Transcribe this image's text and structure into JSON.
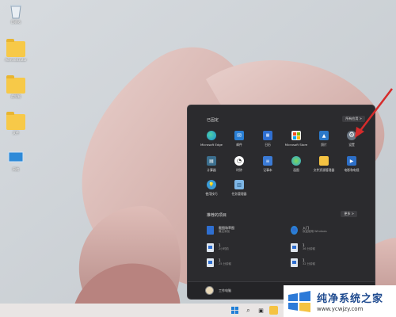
{
  "desktop": {
    "icons": [
      {
        "label": "回收站",
        "kind": "recycle"
      },
      {
        "label": "Administrator",
        "kind": "folder"
      },
      {
        "label": "此电脑",
        "kind": "folder"
      },
      {
        "label": "文件",
        "kind": "folder"
      },
      {
        "label": "网络",
        "kind": "monitor"
      }
    ]
  },
  "start_menu": {
    "pinned_title": "已固定",
    "all_apps_label": "所有应用 >",
    "pinned": [
      {
        "name": "Microsoft Edge",
        "icon": "edge-icon",
        "color": "#1a8fd6"
      },
      {
        "name": "邮件",
        "icon": "mail-icon",
        "color": "#2a7fd4"
      },
      {
        "name": "日历",
        "icon": "calendar-icon",
        "color": "#2f6fd1"
      },
      {
        "name": "Microsoft Store",
        "icon": "store-icon",
        "color": "#f3f3f3"
      },
      {
        "name": "照片",
        "icon": "photos-icon",
        "color": "#2b78c8"
      },
      {
        "name": "设置",
        "icon": "gear-icon",
        "color": "#6b7784"
      },
      {
        "name": "计算器",
        "icon": "calculator-icon",
        "color": "#3c6f8e"
      },
      {
        "name": "时钟",
        "icon": "clock-icon",
        "color": "#ffffff"
      },
      {
        "name": "记事本",
        "icon": "notepad-icon",
        "color": "#3b7bd6"
      },
      {
        "name": "画图",
        "icon": "paint-icon",
        "color": "#2aa1d8"
      },
      {
        "name": "文件资源管理器",
        "icon": "folder-icon",
        "color": "#f5c342"
      },
      {
        "name": "电影和电视",
        "icon": "movies-icon",
        "color": "#2d6fc7"
      },
      {
        "name": "使用技巧",
        "icon": "tips-icon",
        "color": "#3a9bd6"
      },
      {
        "name": "任务管理器",
        "icon": "taskmanager-icon",
        "color": "#7fb7e6"
      }
    ],
    "recommended_title": "推荐的项目",
    "more_label": "更多 >",
    "recommended": [
      {
        "title": "截图和草图",
        "sub": "最近添加",
        "icon": "snip-icon"
      },
      {
        "title": "入门",
        "sub": "欢迎使用 Windows",
        "icon": "getstarted-icon"
      },
      {
        "title": "1",
        "sub": "2小时前",
        "icon": "doc-icon"
      },
      {
        "title": "1",
        "sub": "36 分钟前",
        "icon": "doc-icon"
      },
      {
        "title": "1",
        "sub": "25 分钟前",
        "icon": "doc-icon"
      },
      {
        "title": "1",
        "sub": "32 分钟前",
        "icon": "doc-icon"
      }
    ],
    "user_name": "工作电脑"
  },
  "watermark": {
    "text": "纯净系统之家",
    "url": "www.ycwjzy.com"
  },
  "colors": {
    "accent": "#c9302c",
    "menu_bg": "#2b2b2e"
  }
}
